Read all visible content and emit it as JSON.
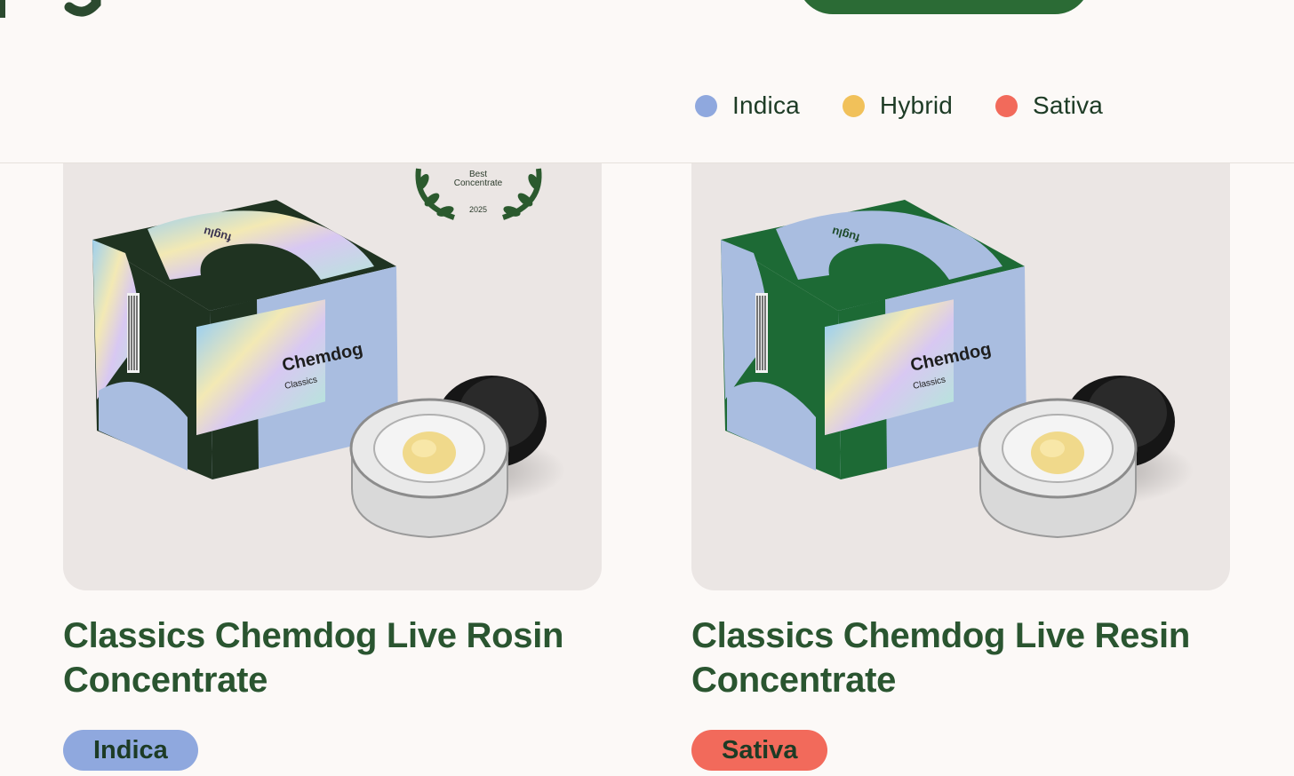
{
  "colors": {
    "indica": "#8fa8de",
    "hybrid": "#f1c15a",
    "sativa": "#f26a5b",
    "brand_green": "#2b6b35",
    "title_green": "#2a5530"
  },
  "legend": [
    {
      "label": "Indica",
      "color": "#8fa8de"
    },
    {
      "label": "Hybrid",
      "color": "#f1c15a"
    },
    {
      "label": "Sativa",
      "color": "#f26a5b"
    }
  ],
  "products": [
    {
      "title": "Classics Chemdog Live Rosin Concentrate",
      "strain": "Indica",
      "strain_color": "#8fa8de",
      "box_color": "#1f3321",
      "award": {
        "line1": "Best",
        "line2": "Concentrate",
        "year": "2025"
      },
      "package": {
        "brand": "fuglu",
        "name": "Chemdog",
        "sub": "Classics"
      }
    },
    {
      "title": "Classics Chemdog Live Resin Concentrate",
      "strain": "Sativa",
      "strain_color": "#f26a5b",
      "box_color": "#1d6a35",
      "package": {
        "brand": "fuglu",
        "name": "Chemdog",
        "sub": "Classics"
      }
    }
  ]
}
